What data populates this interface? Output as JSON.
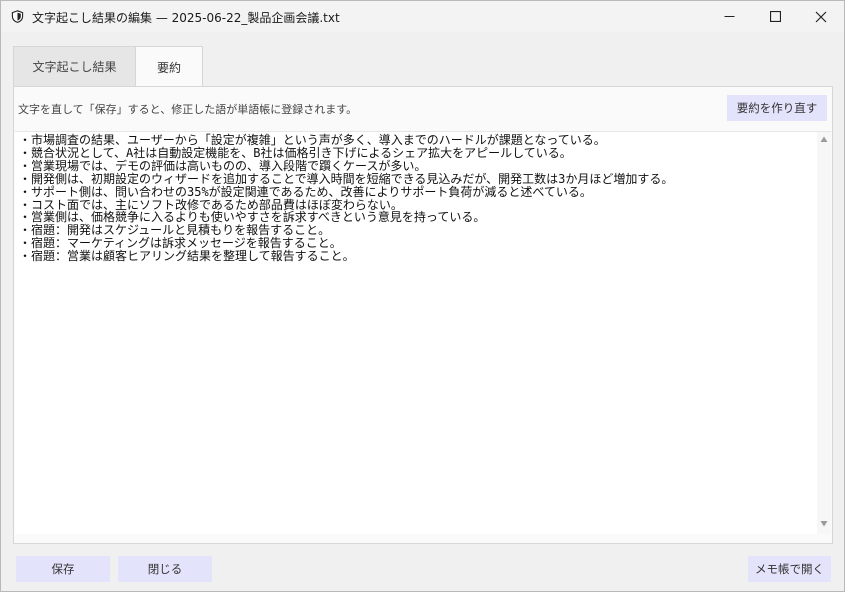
{
  "window": {
    "title": "文字起こし結果の編集 — 2025-06-22_製品企画会議.txt",
    "icons": {
      "app": "shield-icon",
      "minimize": "minimize-icon",
      "maximize": "maximize-icon",
      "close": "close-icon"
    }
  },
  "tabs": [
    {
      "label": "文字起こし結果",
      "selected": false
    },
    {
      "label": "要約",
      "selected": true
    }
  ],
  "summary_panel": {
    "hint": "文字を直して「保存」すると、修正した語が単語帳に登録されます。",
    "regenerate_label": "要約を作り直す",
    "lines": [
      "・市場調査の結果、ユーザーから「設定が複雑」という声が多く、導入までのハードルが課題となっている。",
      "・競合状況として、A社は自動設定機能を、B社は価格引き下げによるシェア拡大をアピールしている。",
      "・営業現場では、デモの評価は高いものの、導入段階で躓くケースが多い。",
      "・開発側は、初期設定のウィザードを追加することで導入時間を短縮できる見込みだが、開発工数は3か月ほど増加する。",
      "・サポート側は、問い合わせの35%が設定関連であるため、改善によりサポート負荷が減ると述べている。",
      "・コスト面では、主にソフト改修であるため部品費はほぼ変わらない。",
      "・営業側は、価格競争に入るよりも使いやすさを訴求すべきという意見を持っている。",
      "・宿題：開発はスケジュールと見積もりを報告すること。",
      "・宿題：マーケティングは訴求メッセージを報告すること。",
      "・宿題：営業は顧客ヒアリング結果を整理して報告すること。"
    ]
  },
  "footer": {
    "save_label": "保存",
    "close_label": "閉じる",
    "notepad_label": "メモ帳で開く"
  }
}
